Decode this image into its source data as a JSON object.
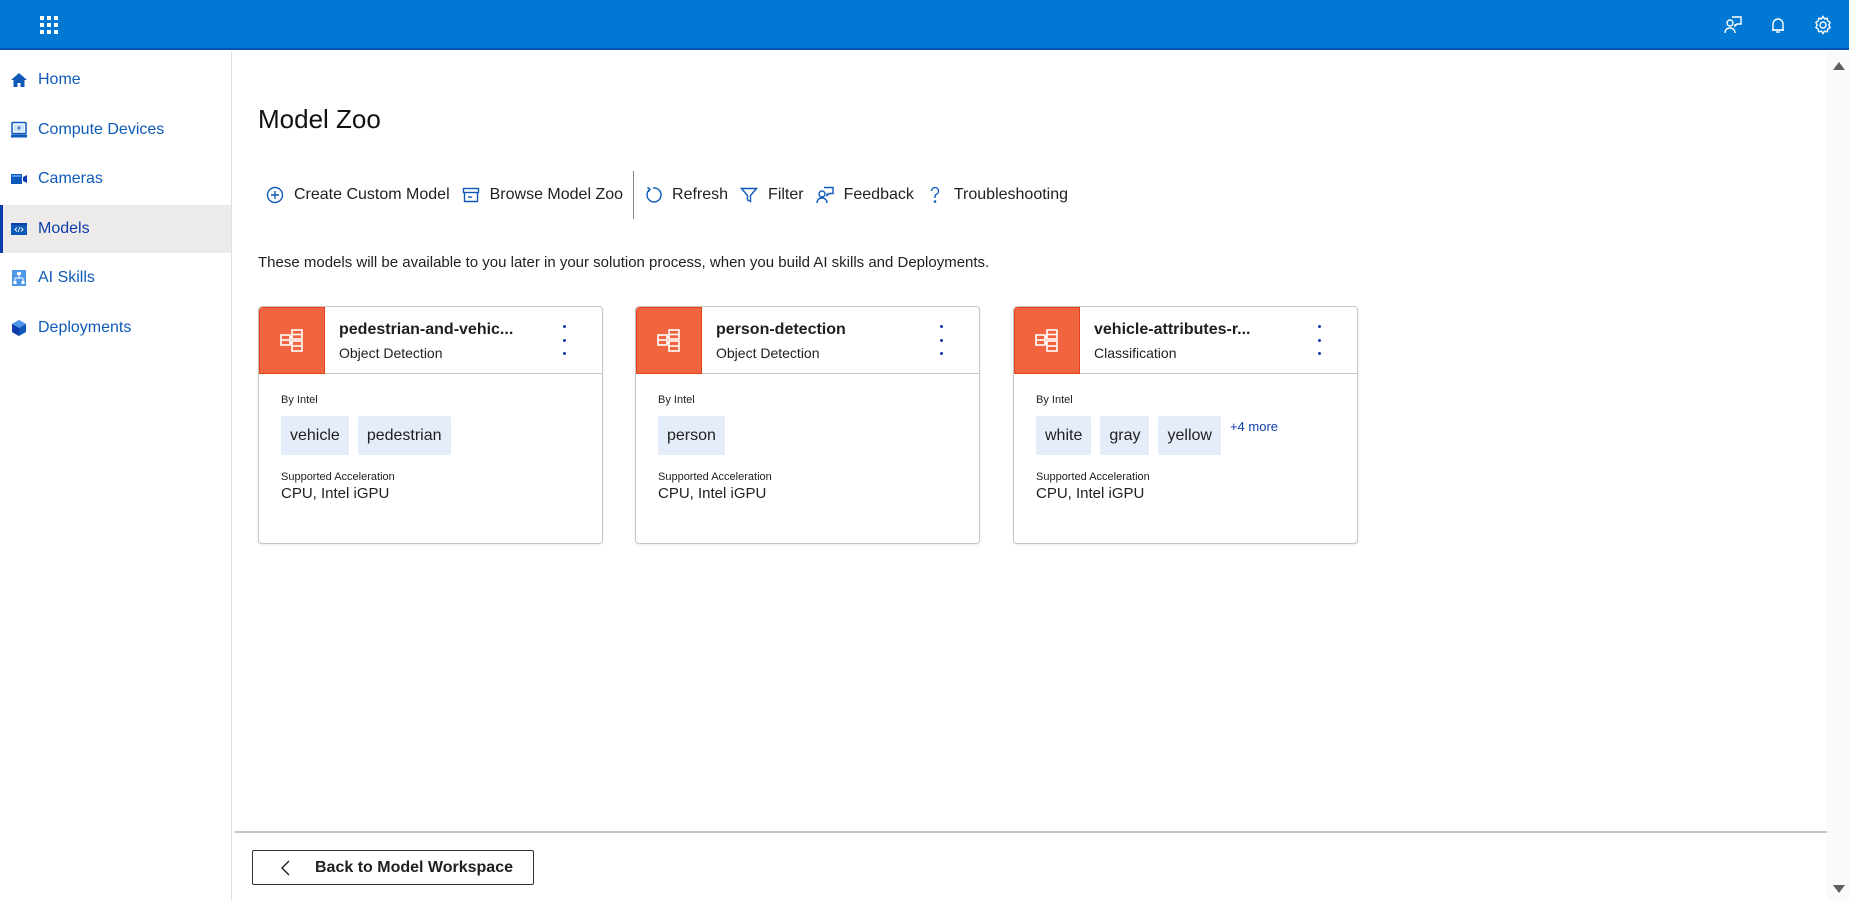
{
  "topbar": {
    "app_launcher_icon": "waffle-icon",
    "icons": [
      "feedback-icon",
      "bell-icon",
      "gear-icon"
    ]
  },
  "sidebar": {
    "items": [
      {
        "label": "Home",
        "icon": "home-icon",
        "active": false
      },
      {
        "label": "Compute Devices",
        "icon": "compute-device-icon",
        "active": false
      },
      {
        "label": "Cameras",
        "icon": "camera-icon",
        "active": false
      },
      {
        "label": "Models",
        "icon": "model-icon",
        "active": true
      },
      {
        "label": "AI Skills",
        "icon": "ai-skill-icon",
        "active": false
      },
      {
        "label": "Deployments",
        "icon": "deployment-icon",
        "active": false
      }
    ]
  },
  "main": {
    "title": "Model Zoo",
    "toolbar": {
      "create_custom_model": "Create Custom Model",
      "browse_model_zoo": "Browse Model Zoo",
      "refresh": "Refresh",
      "filter": "Filter",
      "feedback": "Feedback",
      "troubleshooting": "Troubleshooting"
    },
    "description": "These models will be available to you later in your solution process, when you build AI skills and Deployments.",
    "cards": [
      {
        "name": "pedestrian-and-vehic...",
        "type": "Object Detection",
        "by": "By Intel",
        "tags": [
          "vehicle",
          "pedestrian"
        ],
        "more": "",
        "accel_label": "Supported Acceleration",
        "accel_value": "CPU, Intel iGPU"
      },
      {
        "name": "person-detection",
        "type": "Object Detection",
        "by": "By Intel",
        "tags": [
          "person"
        ],
        "more": "",
        "accel_label": "Supported Acceleration",
        "accel_value": "CPU, Intel iGPU"
      },
      {
        "name": "vehicle-attributes-r...",
        "type": "Classification",
        "by": "By Intel",
        "tags": [
          "white",
          "gray",
          "yellow"
        ],
        "more": "+4 more",
        "accel_label": "Supported Acceleration",
        "accel_value": "CPU, Intel iGPU"
      }
    ],
    "back_button": "Back to Model Workspace"
  },
  "colors": {
    "header": "#0078d4",
    "accent": "#0f5ab8",
    "card_badge": "#f0643f",
    "tag_bg": "#e5edfb"
  }
}
